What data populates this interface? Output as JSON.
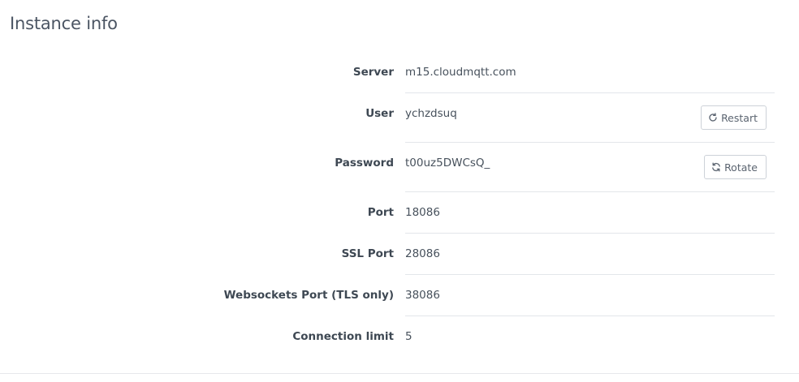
{
  "page": {
    "title": "Instance info"
  },
  "rows": [
    {
      "label": "Server",
      "value": "m15.cloudmqtt.com"
    },
    {
      "label": "User",
      "value": "ychzdsuq",
      "action": {
        "label": "Restart",
        "icon": "refresh-icon"
      }
    },
    {
      "label": "Password",
      "value": "t00uz5DWCsQ_",
      "action": {
        "label": "Rotate",
        "icon": "rotate-icon"
      }
    },
    {
      "label": "Port",
      "value": "18086"
    },
    {
      "label": "SSL Port",
      "value": "28086"
    },
    {
      "label": "Websockets Port (TLS only)",
      "value": "38086"
    },
    {
      "label": "Connection limit",
      "value": "5"
    }
  ],
  "colors": {
    "text": "#3e4853",
    "border": "#e3e6ea",
    "button_border": "#cdd2d8"
  }
}
